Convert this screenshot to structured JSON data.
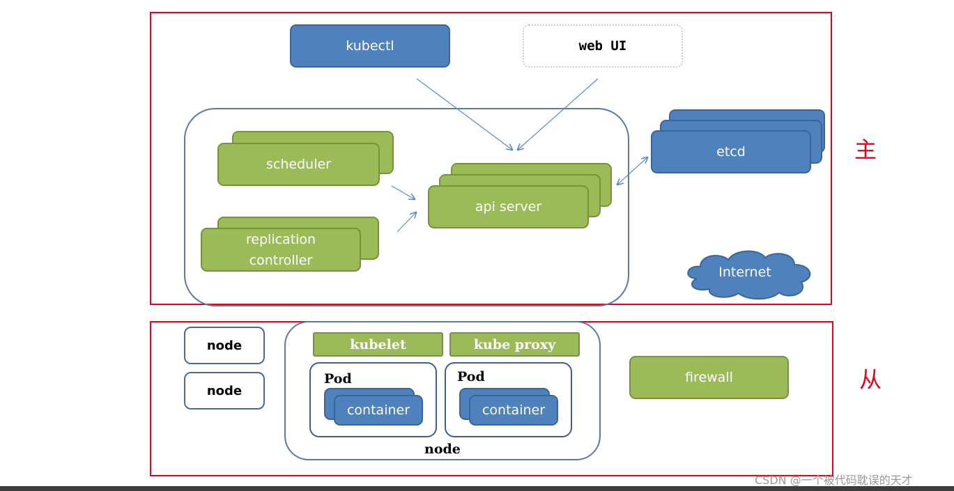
{
  "master": {
    "label": "主",
    "kubectl": "kubectl",
    "web_ui": "web UI",
    "scheduler": "scheduler",
    "replication_controller": "replication controller",
    "api_server": "api server",
    "etcd": "etcd",
    "internet": "Internet"
  },
  "worker": {
    "label": "从",
    "nodes": [
      "node",
      "node"
    ],
    "kubelet": "kubelet",
    "kube_proxy": "kube proxy",
    "pods": [
      {
        "label": "Pod",
        "container": "container"
      },
      {
        "label": "Pod",
        "container": "container"
      }
    ],
    "node_label": "node",
    "firewall": "firewall"
  },
  "watermark": "CSDN @一个被代码耽误的天才",
  "colors": {
    "blue": "#4f81bd",
    "green": "#9bbb59",
    "red": "#e8001c"
  }
}
